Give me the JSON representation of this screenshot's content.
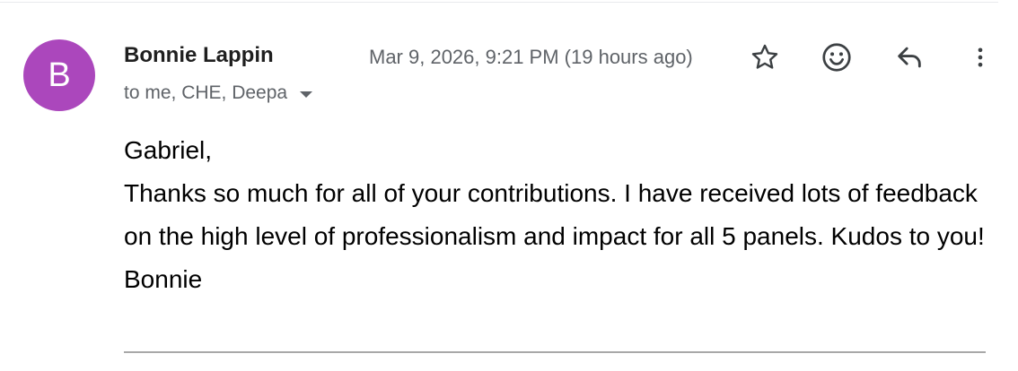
{
  "message": {
    "avatar_letter": "B",
    "avatar_color": "#ab47bc",
    "sender_name": "Bonnie Lappin",
    "recipients": "to me, CHE, Deepa",
    "timestamp": "Mar 9, 2026, 9:21 PM (19 hours ago)",
    "body": {
      "greeting": "Gabriel,",
      "paragraph": "Thanks so much for all of your contributions. I have received lots of feedback on the high level of professionalism and impact for all 5 panels. Kudos to you!",
      "signature": "Bonnie"
    }
  },
  "actions": {
    "star_icon": "star-outline-icon",
    "emoji_icon": "emoji-smile-icon",
    "reply_icon": "reply-arrow-icon",
    "more_icon": "more-vertical-icon"
  }
}
